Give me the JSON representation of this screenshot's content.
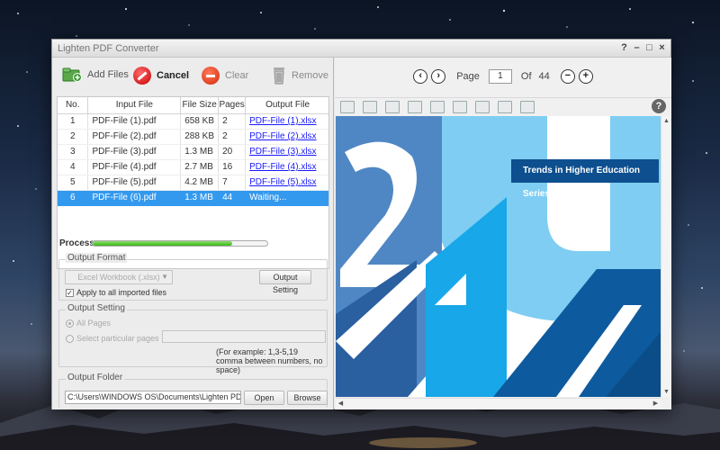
{
  "window": {
    "title": "Lighten PDF Converter",
    "controls": [
      "?",
      "–",
      "□",
      "×"
    ]
  },
  "toolbar": {
    "add_files": "Add Files",
    "cancel": "Cancel",
    "clear": "Clear",
    "remove": "Remove"
  },
  "file_table": {
    "headers": [
      "No.",
      "Input File",
      "File Size",
      "Pages",
      "Output File"
    ],
    "rows": [
      {
        "no": "1",
        "input": "PDF-File (1).pdf",
        "size": "658 KB",
        "pages": "2",
        "output": "PDF-File (1).xlsx"
      },
      {
        "no": "2",
        "input": "PDF-File (2).pdf",
        "size": "288 KB",
        "pages": "2",
        "output": "PDF-File (2).xlsx"
      },
      {
        "no": "3",
        "input": "PDF-File (3).pdf",
        "size": "1.3 MB",
        "pages": "20",
        "output": "PDF-File (3).xlsx"
      },
      {
        "no": "4",
        "input": "PDF-File (4).pdf",
        "size": "2.7 MB",
        "pages": "16",
        "output": "PDF-File (4).xlsx"
      },
      {
        "no": "5",
        "input": "PDF-File (5).pdf",
        "size": "4.2 MB",
        "pages": "7",
        "output": "PDF-File (5).xlsx"
      },
      {
        "no": "6",
        "input": "PDF-File (6).pdf",
        "size": "1.3 MB",
        "pages": "44",
        "output": "Waiting..."
      }
    ],
    "selected_row": 5
  },
  "process": {
    "label": "Process:",
    "progress": 0.8
  },
  "output_format": {
    "title": "Output Format",
    "selected": "Excel Workbook (.xlsx)",
    "setting_button": "Output Setting",
    "apply_all_label": "Apply to all imported files",
    "apply_all_checked": true
  },
  "output_setting": {
    "title": "Output Setting",
    "all_pages": "All Pages",
    "select_pages": "Select particular pages",
    "hint_line1": "(For example: 1,3-5,19",
    "hint_line2": "comma between numbers, no space)"
  },
  "output_folder": {
    "title": "Output Folder",
    "path": "C:\\Users\\WINDOWS OS\\Documents\\Lighten PDF Converter",
    "open": "Open",
    "browse": "Browse"
  },
  "viewer": {
    "page_label": "Page",
    "current_page": "1",
    "of_label": "Of",
    "total_pages": "44",
    "doc_title": "Trends in Higher Education Series",
    "help": "?"
  },
  "colors": {
    "selection": "#3399ee",
    "progress": "#3ab51a",
    "doc_dark_blue": "#0d4f8f",
    "doc_light_blue": "#7fcdf3",
    "doc_mid_blue": "#3f86c6"
  }
}
